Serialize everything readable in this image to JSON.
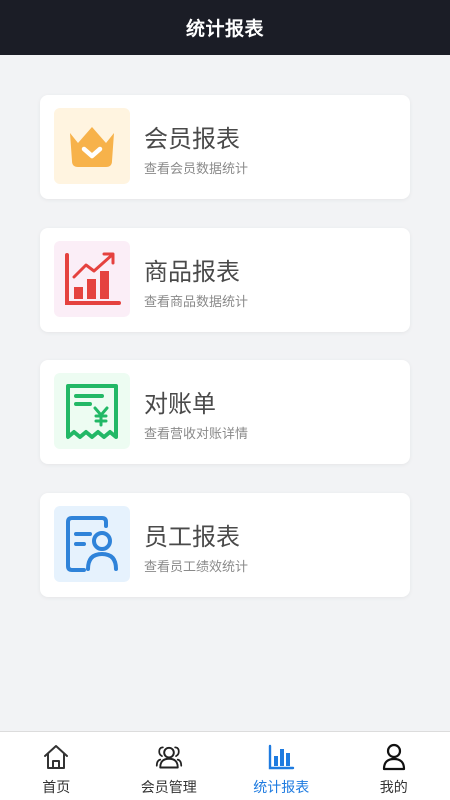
{
  "header": {
    "title": "统计报表"
  },
  "cards": [
    {
      "title": "会员报表",
      "subtitle": "查看会员数据统计",
      "icon": "crown-icon"
    },
    {
      "title": "商品报表",
      "subtitle": "查看商品数据统计",
      "icon": "bar-chart-trend-icon"
    },
    {
      "title": "对账单",
      "subtitle": "查看营收对账详情",
      "icon": "receipt-yen-icon"
    },
    {
      "title": "员工报表",
      "subtitle": "查看员工绩效统计",
      "icon": "employee-card-icon"
    }
  ],
  "tabbar": {
    "items": [
      {
        "label": "首页",
        "icon": "home-icon"
      },
      {
        "label": "会员管理",
        "icon": "members-icon"
      },
      {
        "label": "统计报表",
        "icon": "bar-chart-icon",
        "active": true
      },
      {
        "label": "我的",
        "icon": "user-icon"
      }
    ]
  },
  "colors": {
    "header_bg": "#1b1d26",
    "accent": "#1e7be0",
    "crown": "#f7b24a",
    "chart_red": "#e5423f",
    "receipt_green": "#22b866",
    "employee_blue": "#2f83d9"
  }
}
